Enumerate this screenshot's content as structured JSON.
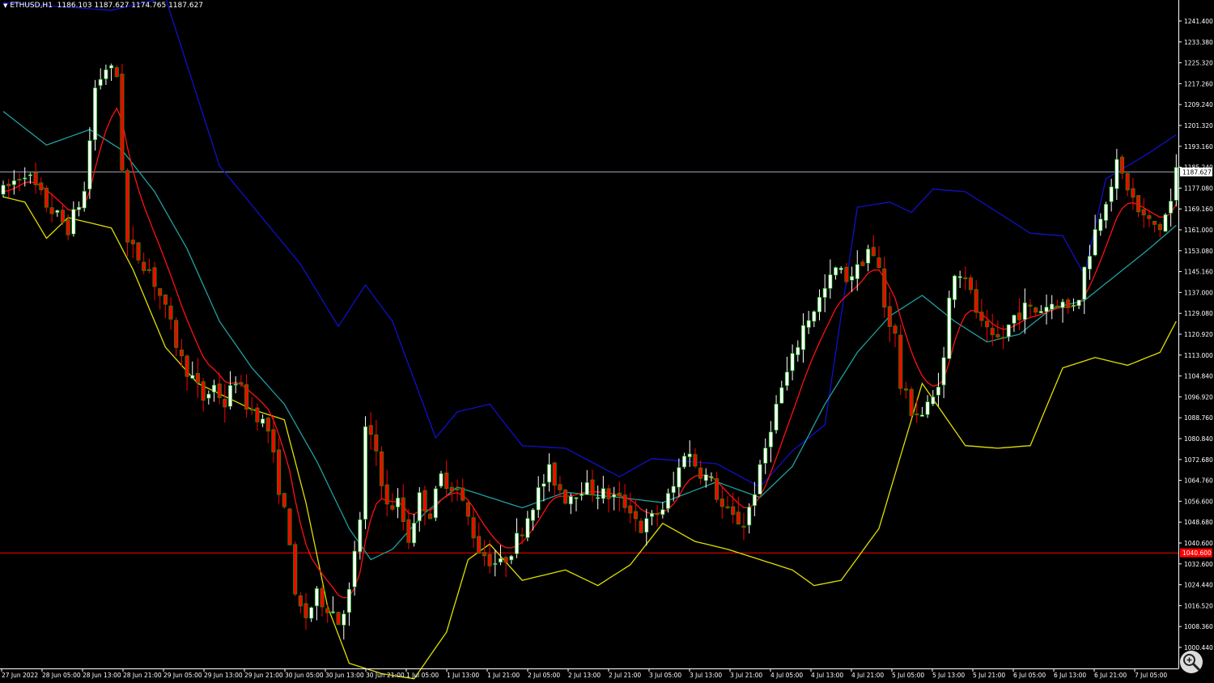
{
  "window": {
    "symbol": "ETHUSD,H1",
    "ohlc": "1186.103 1187.627 1174.765 1187.627"
  },
  "colors": {
    "background": "#000000",
    "bull_candle": "#ffffff",
    "bear_candle": "#ff0000",
    "doji_candle": "#00a000",
    "upper_band": "#1010c8",
    "lower_band": "#e0e000",
    "middle_band": "#20a0a0",
    "fast_ma": "#ff1010",
    "bid_line": "#9aa4b2",
    "level_line": "#ff0000",
    "axis_text": "#ffffff"
  },
  "price_axis": {
    "labels": [
      "1241.400",
      "1233.380",
      "1225.320",
      "1217.260",
      "1209.240",
      "1201.320",
      "1193.160",
      "1185.240",
      "1177.080",
      "1169.160",
      "1161.000",
      "1153.080",
      "1145.160",
      "1137.000",
      "1129.080",
      "1120.920",
      "1113.000",
      "1104.840",
      "1096.920",
      "1088.760",
      "1080.840",
      "1072.680",
      "1064.760",
      "1056.600",
      "1048.680",
      "1040.600",
      "1032.600",
      "1024.440",
      "1016.520",
      "1008.360",
      "1000.440"
    ],
    "bid_tag": "1187.627",
    "level_tag": "1040.600"
  },
  "time_axis": {
    "labels": [
      "27 Jun 2022",
      "28 Jun 05:00",
      "28 Jun 13:00",
      "28 Jun 21:00",
      "29 Jun 05:00",
      "29 Jun 13:00",
      "29 Jun 21:00",
      "30 Jun 05:00",
      "30 Jun 13:00",
      "30 Jun 21:00",
      "1 Jul 05:00",
      "1 Jul 13:00",
      "1 Jul 21:00",
      "2 Jul 05:00",
      "2 Jul 13:00",
      "2 Jul 21:00",
      "3 Jul 05:00",
      "3 Jul 13:00",
      "3 Jul 21:00",
      "4 Jul 05:00",
      "4 Jul 13:00",
      "4 Jul 21:00",
      "5 Jul 05:00",
      "5 Jul 13:00",
      "5 Jul 21:00",
      "6 Jul 05:00",
      "6 Jul 13:00",
      "6 Jul 21:00",
      "7 Jul 05:00"
    ]
  },
  "chart_data": {
    "type": "candlestick",
    "symbol": "ETHUSD",
    "timeframe": "H1",
    "ylim": [
      996,
      1254
    ],
    "bid": 1187.627,
    "level": 1040.6,
    "close_path": [
      [
        0,
        1180
      ],
      [
        4,
        1188
      ],
      [
        8,
        1175
      ],
      [
        12,
        1166
      ],
      [
        15,
        1180
      ],
      [
        17,
        1220
      ],
      [
        19,
        1228
      ],
      [
        21,
        1225
      ],
      [
        22,
        1190
      ],
      [
        23,
        1160
      ],
      [
        25,
        1155
      ],
      [
        27,
        1150
      ],
      [
        29,
        1140
      ],
      [
        31,
        1128
      ],
      [
        33,
        1115
      ],
      [
        35,
        1108
      ],
      [
        37,
        1100
      ],
      [
        39,
        1105
      ],
      [
        41,
        1098
      ],
      [
        43,
        1108
      ],
      [
        45,
        1098
      ],
      [
        47,
        1094
      ],
      [
        49,
        1088
      ],
      [
        51,
        1066
      ],
      [
        53,
        1046
      ],
      [
        54,
        1022
      ],
      [
        56,
        1016
      ],
      [
        58,
        1024
      ],
      [
        61,
        1018
      ],
      [
        62,
        1014
      ],
      [
        64,
        1025
      ],
      [
        66,
        1054
      ],
      [
        67,
        1088
      ],
      [
        69,
        1080
      ],
      [
        71,
        1058
      ],
      [
        73,
        1060
      ],
      [
        75,
        1046
      ],
      [
        77,
        1062
      ],
      [
        79,
        1056
      ],
      [
        81,
        1070
      ],
      [
        84,
        1065
      ],
      [
        86,
        1054
      ],
      [
        88,
        1042
      ],
      [
        90,
        1038
      ],
      [
        92,
        1036
      ],
      [
        94,
        1042
      ],
      [
        96,
        1050
      ],
      [
        98,
        1060
      ],
      [
        101,
        1072
      ],
      [
        104,
        1062
      ],
      [
        107,
        1066
      ],
      [
        110,
        1064
      ],
      [
        113,
        1062
      ],
      [
        116,
        1058
      ],
      [
        118,
        1050
      ],
      [
        120,
        1054
      ],
      [
        122,
        1058
      ],
      [
        124,
        1066
      ],
      [
        126,
        1080
      ],
      [
        127,
        1078
      ],
      [
        129,
        1072
      ],
      [
        131,
        1068
      ],
      [
        133,
        1058
      ],
      [
        135,
        1054
      ],
      [
        137,
        1052
      ],
      [
        138,
        1058
      ],
      [
        140,
        1072
      ],
      [
        142,
        1090
      ],
      [
        144,
        1104
      ],
      [
        146,
        1115
      ],
      [
        148,
        1128
      ],
      [
        150,
        1135
      ],
      [
        152,
        1142
      ],
      [
        154,
        1150
      ],
      [
        156,
        1147
      ],
      [
        158,
        1150
      ],
      [
        160,
        1158
      ],
      [
        162,
        1150
      ],
      [
        163,
        1136
      ],
      [
        165,
        1124
      ],
      [
        166,
        1105
      ],
      [
        168,
        1096
      ],
      [
        170,
        1094
      ],
      [
        172,
        1100
      ],
      [
        174,
        1115
      ],
      [
        175,
        1138
      ],
      [
        176,
        1150
      ],
      [
        178,
        1148
      ],
      [
        179,
        1140
      ],
      [
        181,
        1128
      ],
      [
        183,
        1122
      ],
      [
        185,
        1124
      ],
      [
        187,
        1132
      ],
      [
        189,
        1135
      ],
      [
        191,
        1134
      ],
      [
        193,
        1136
      ],
      [
        195,
        1138
      ],
      [
        197,
        1135
      ],
      [
        199,
        1140
      ],
      [
        200,
        1150
      ],
      [
        202,
        1165
      ],
      [
        204,
        1178
      ],
      [
        206,
        1190
      ],
      [
        208,
        1182
      ],
      [
        210,
        1172
      ],
      [
        212,
        1168
      ],
      [
        214,
        1166
      ],
      [
        216,
        1176
      ],
      [
        217,
        1188
      ]
    ],
    "upper_band": [
      [
        0,
        1253
      ],
      [
        20,
        1250
      ],
      [
        30,
        1255
      ],
      [
        40,
        1190
      ],
      [
        55,
        1152
      ],
      [
        62,
        1128
      ],
      [
        67,
        1144
      ],
      [
        72,
        1130
      ],
      [
        80,
        1085
      ],
      [
        84,
        1095
      ],
      [
        90,
        1098
      ],
      [
        96,
        1082
      ],
      [
        104,
        1081
      ],
      [
        114,
        1070
      ],
      [
        120,
        1077
      ],
      [
        132,
        1075
      ],
      [
        140,
        1066
      ],
      [
        146,
        1080
      ],
      [
        152,
        1090
      ],
      [
        158,
        1174
      ],
      [
        164,
        1176
      ],
      [
        168,
        1172
      ],
      [
        172,
        1181
      ],
      [
        178,
        1180
      ],
      [
        184,
        1172
      ],
      [
        190,
        1164
      ],
      [
        196,
        1163
      ],
      [
        200,
        1148
      ],
      [
        204,
        1185
      ],
      [
        212,
        1195
      ],
      [
        217,
        1202
      ]
    ],
    "middle_band": [
      [
        0,
        1211
      ],
      [
        8,
        1198
      ],
      [
        16,
        1204
      ],
      [
        22,
        1196
      ],
      [
        28,
        1180
      ],
      [
        34,
        1158
      ],
      [
        40,
        1130
      ],
      [
        46,
        1112
      ],
      [
        52,
        1098
      ],
      [
        58,
        1076
      ],
      [
        64,
        1050
      ],
      [
        68,
        1038
      ],
      [
        72,
        1042
      ],
      [
        78,
        1056
      ],
      [
        84,
        1066
      ],
      [
        90,
        1062
      ],
      [
        96,
        1058
      ],
      [
        104,
        1064
      ],
      [
        114,
        1062
      ],
      [
        122,
        1060
      ],
      [
        132,
        1068
      ],
      [
        140,
        1062
      ],
      [
        146,
        1074
      ],
      [
        152,
        1098
      ],
      [
        158,
        1118
      ],
      [
        164,
        1132
      ],
      [
        170,
        1140
      ],
      [
        176,
        1130
      ],
      [
        182,
        1122
      ],
      [
        188,
        1125
      ],
      [
        194,
        1135
      ],
      [
        200,
        1138
      ],
      [
        206,
        1148
      ],
      [
        212,
        1158
      ],
      [
        217,
        1167
      ]
    ],
    "lower_band": [
      [
        0,
        1178
      ],
      [
        4,
        1176
      ],
      [
        8,
        1162
      ],
      [
        12,
        1170
      ],
      [
        20,
        1166
      ],
      [
        24,
        1150
      ],
      [
        30,
        1120
      ],
      [
        36,
        1106
      ],
      [
        40,
        1102
      ],
      [
        46,
        1096
      ],
      [
        52,
        1092
      ],
      [
        56,
        1060
      ],
      [
        60,
        1020
      ],
      [
        64,
        998
      ],
      [
        70,
        994
      ],
      [
        76,
        992
      ],
      [
        82,
        1010
      ],
      [
        86,
        1038
      ],
      [
        90,
        1044
      ],
      [
        96,
        1030
      ],
      [
        104,
        1034
      ],
      [
        110,
        1028
      ],
      [
        116,
        1036
      ],
      [
        122,
        1052
      ],
      [
        128,
        1045
      ],
      [
        134,
        1042
      ],
      [
        140,
        1038
      ],
      [
        146,
        1034
      ],
      [
        150,
        1028
      ],
      [
        155,
        1030
      ],
      [
        162,
        1050
      ],
      [
        170,
        1106
      ],
      [
        178,
        1082
      ],
      [
        184,
        1081
      ],
      [
        190,
        1082
      ],
      [
        196,
        1112
      ],
      [
        202,
        1116
      ],
      [
        208,
        1113
      ],
      [
        214,
        1118
      ],
      [
        217,
        1130
      ]
    ]
  }
}
